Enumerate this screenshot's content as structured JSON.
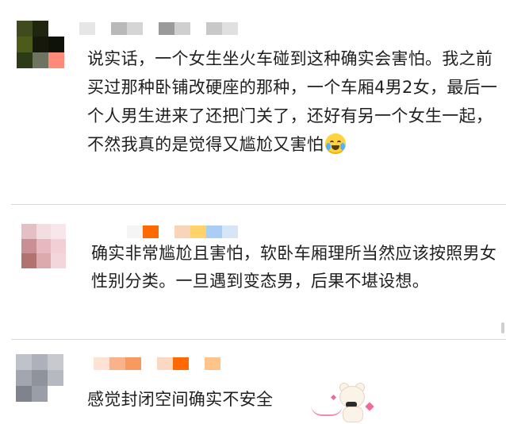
{
  "comments": [
    {
      "text": "说实话，一个女生坐火车碰到这种确实会害怕。我之前买过那种卧铺改硬座的那种，一个车厢4男2女，最后一个人男生进来了还把门关了，还好有另一个女生一起，不然我真的是觉得又尴尬又害怕",
      "emoji": "crying-laughing-emoji",
      "avatar_colors": [
        "#3f4a1f",
        "#20250f",
        "#ffffff",
        "#4c5a1a",
        "#15180a",
        "#0f1208",
        "#2d3a16",
        "#6f7361",
        "#ff8a7a"
      ],
      "name_blur_colors": [
        "#e6e6e6",
        "#ffffff",
        "#b9b9b9",
        "#d5d5d5",
        "#ffffff",
        "#9a9a9a",
        "#cfcfcf",
        "#ffffff",
        "#c8c8c8",
        "#e0e0e0"
      ]
    },
    {
      "text": "确实非常尴尬且害怕，软卧车厢理所当然应该按照男女性别分类。一旦遇到变态男，后果不堪设想。",
      "avatar_colors": [
        "#e3c0c3",
        "#f2dde0",
        "#f7e7ea",
        "#c98f95",
        "#e8b8bf",
        "#f2cfd5",
        "#b2726f",
        "#dca9ad",
        "#f3d6dc"
      ],
      "name_blur_colors": [
        "#f5f5f5",
        "#ff6a00",
        "#ffffff",
        "#f8d5b9",
        "#ffd36a",
        "#a9cdf4",
        "#d6e6f7"
      ]
    },
    {
      "text": "感觉封闭空间确实不安全",
      "avatar_colors": [
        "#c0c2c9",
        "#aeb1b9",
        "#c7c9cf",
        "#a3a6ae",
        "#8f939c",
        "#b6b9c0",
        "#7f838c",
        "#9a9ea6",
        "#ffffff"
      ],
      "name_blur_colors": [
        "#fde3d3",
        "#f8b38d",
        "#f69a61",
        "#ffffff",
        "#fcd7c2",
        "#ff6a00",
        "#ffffff",
        "#ffc48a"
      ]
    }
  ]
}
